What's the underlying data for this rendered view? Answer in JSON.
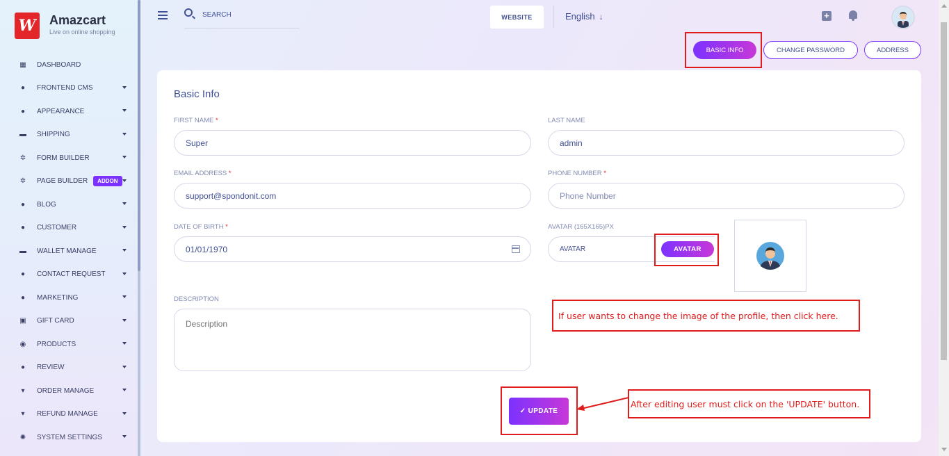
{
  "brand": {
    "logo_mark": "W",
    "title": "Amazcart",
    "subtitle": "Live on online shopping"
  },
  "sidebar": {
    "items": [
      {
        "label": "DASHBOARD",
        "icon": "grid-icon",
        "glyph": "▦",
        "chevron": false
      },
      {
        "label": "FRONTEND CMS",
        "icon": "user-icon",
        "glyph": "●",
        "chevron": true
      },
      {
        "label": "APPEARANCE",
        "icon": "user-icon",
        "glyph": "●",
        "chevron": true
      },
      {
        "label": "SHIPPING",
        "icon": "money-icon",
        "glyph": "▬",
        "chevron": true
      },
      {
        "label": "FORM BUILDER",
        "icon": "cogs-icon",
        "glyph": "✲",
        "chevron": true
      },
      {
        "label": "PAGE BUILDER",
        "icon": "cogs-icon",
        "glyph": "✲",
        "chevron": true,
        "badge": "ADDON"
      },
      {
        "label": "BLOG",
        "icon": "users-icon",
        "glyph": "●",
        "chevron": true
      },
      {
        "label": "CUSTOMER",
        "icon": "users-icon",
        "glyph": "●",
        "chevron": true
      },
      {
        "label": "WALLET MANAGE",
        "icon": "wallet-icon",
        "glyph": "▬",
        "chevron": true
      },
      {
        "label": "CONTACT REQUEST",
        "icon": "user-icon",
        "glyph": "●",
        "chevron": true
      },
      {
        "label": "MARKETING",
        "icon": "user-icon",
        "glyph": "●",
        "chevron": true
      },
      {
        "label": "GIFT CARD",
        "icon": "gift-icon",
        "glyph": "▣",
        "chevron": true
      },
      {
        "label": "PRODUCTS",
        "icon": "product-icon",
        "glyph": "◉",
        "chevron": true
      },
      {
        "label": "REVIEW",
        "icon": "user-icon",
        "glyph": "●",
        "chevron": true
      },
      {
        "label": "ORDER MANAGE",
        "icon": "cart-icon",
        "glyph": "▾",
        "chevron": true
      },
      {
        "label": "REFUND MANAGE",
        "icon": "cart-icon",
        "glyph": "▾",
        "chevron": true
      },
      {
        "label": "SYSTEM SETTINGS",
        "icon": "gear-icon",
        "glyph": "✺",
        "chevron": true
      }
    ]
  },
  "header": {
    "search_placeholder": "SEARCH",
    "website_label": "WEBSITE",
    "language": "English",
    "language_arrow": "↓",
    "plus_glyph": "+"
  },
  "tabs": [
    {
      "label": "BASIC INFO",
      "active": true
    },
    {
      "label": "CHANGE PASSWORD",
      "active": false
    },
    {
      "label": "ADDRESS",
      "active": false
    }
  ],
  "form": {
    "title": "Basic Info",
    "first_name_label": "FIRST NAME",
    "first_name_value": "Super",
    "last_name_label": "LAST NAME",
    "last_name_value": "admin",
    "email_label": "EMAIL ADDRESS",
    "email_value": "support@spondonit.com",
    "phone_label": "PHONE NUMBER",
    "phone_placeholder": "Phone Number",
    "dob_label": "DATE OF BIRTH",
    "dob_value": "01/01/1970",
    "avatar_label": "AVATAR (165X165)PX",
    "avatar_field_text": "AVATAR",
    "avatar_button": "AVATAR",
    "description_label": "DESCRIPTION",
    "description_placeholder": "Description",
    "update_button": "✓ UPDATE",
    "required_mark": "*"
  },
  "annotations": {
    "avatar_note": "If user wants to change the image of the profile, then click here.",
    "update_note": "After editing user must click on the 'UPDATE' button."
  },
  "colors": {
    "accent": "#7c32ff",
    "accent_end": "#c738d8",
    "text": "#415094",
    "annotation": "#e01b1b",
    "logo": "#e3262a"
  }
}
